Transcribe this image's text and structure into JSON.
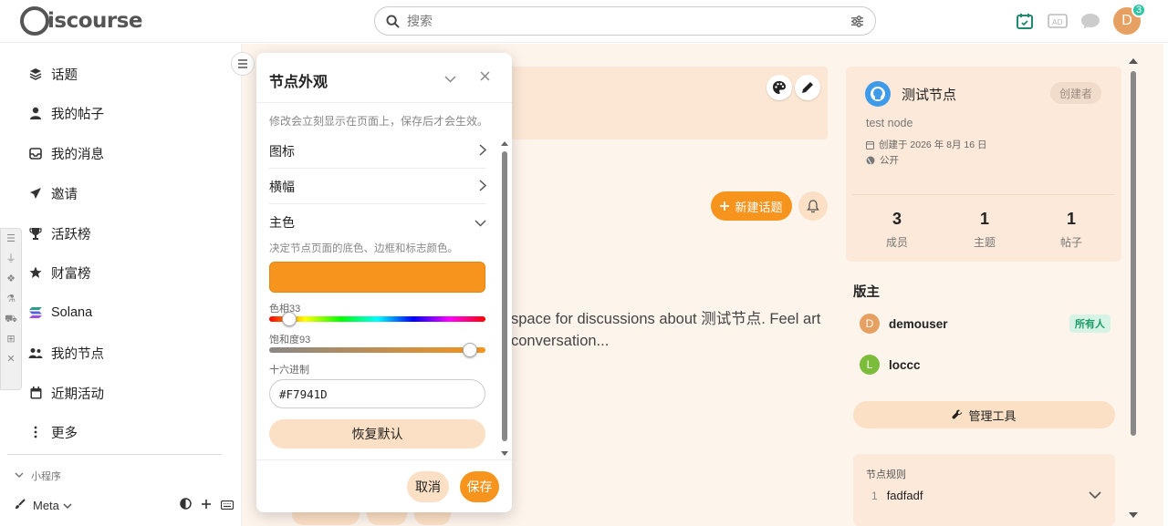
{
  "header": {
    "logo_text": "iscourse",
    "search_placeholder": "搜索",
    "notification_count": "3",
    "avatar_letter": "D"
  },
  "sidebar": {
    "items": [
      {
        "label": "话题",
        "icon": "layers-icon"
      },
      {
        "label": "我的帖子",
        "icon": "user-icon"
      },
      {
        "label": "我的消息",
        "icon": "inbox-icon"
      },
      {
        "label": "邀请",
        "icon": "paper-plane-icon"
      },
      {
        "label": "活跃榜",
        "icon": "trophy-icon"
      },
      {
        "label": "财富榜",
        "icon": "star-icon"
      },
      {
        "label": "Solana",
        "icon": "solana-icon"
      },
      {
        "label": "我的节点",
        "icon": "users-icon"
      },
      {
        "label": "近期活动",
        "icon": "calendar-icon"
      },
      {
        "label": "更多",
        "icon": "ellipsis-vertical-icon"
      }
    ],
    "section_label": "小程序",
    "bottom_label": "Meta"
  },
  "main": {
    "new_topic_label": "新建话题",
    "about_text": "space for discussions about 测试节点. Feel  art conversation..."
  },
  "node": {
    "name": "测试节点",
    "creator_badge": "创建者",
    "description": "test node",
    "created": "创建于 2026 年 8月 16 日",
    "visibility": "公开",
    "stats": [
      {
        "value": "3",
        "label": "成员"
      },
      {
        "value": "1",
        "label": "主题"
      },
      {
        "value": "1",
        "label": "帖子"
      }
    ],
    "moderators_title": "版主",
    "moderators": [
      {
        "letter": "D",
        "name": "demouser",
        "badge": "所有人",
        "color": "#e6a062"
      },
      {
        "letter": "L",
        "name": "loccc",
        "badge": "",
        "color": "#7bbd3a"
      }
    ],
    "manage_label": "管理工具",
    "rules_title": "节点规则",
    "rules": [
      {
        "num": "1",
        "text": "fadfadf"
      }
    ]
  },
  "popover": {
    "title": "节点外观",
    "hint": "修改会立刻显示在页面上，保存后才会生效。",
    "rows": {
      "icon": "图标",
      "banner": "横幅",
      "primary": "主色"
    },
    "primary_desc": "决定节点页面的底色、边框和标志颜色。",
    "color_hex": "#F7941D",
    "hue_label": "色相33",
    "hue_value": 33,
    "saturation_label": "饱和度93",
    "saturation_value": 93,
    "hex_label": "十六进制",
    "hex_value": "#F7941D",
    "restore_label": "恢复默认",
    "cancel_label": "取消",
    "save_label": "保存"
  },
  "colors": {
    "accent": "#f7941d",
    "accent_light": "#fce0c5",
    "main_bg": "#fdf4ec"
  }
}
